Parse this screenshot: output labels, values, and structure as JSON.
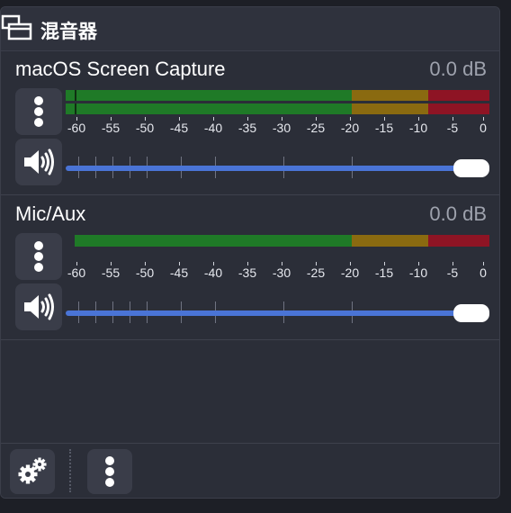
{
  "dock": {
    "title": "混音器",
    "undock_icon": "undock-window-icon"
  },
  "channels": [
    {
      "name": "macOS Screen Capture",
      "db": "0.0 dB",
      "meter_rows": 2,
      "volume_level": 1.0
    },
    {
      "name": "Mic/Aux",
      "db": "0.0 dB",
      "meter_rows": 1,
      "volume_level": 1.0
    }
  ],
  "scale_labels": [
    "-60",
    "-55",
    "-50",
    "-45",
    "-40",
    "-35",
    "-30",
    "-25",
    "-20",
    "-15",
    "-10",
    "-5",
    "0"
  ],
  "colors": {
    "meter_green": "#1f7a27",
    "meter_yellow": "#8a6a10",
    "meter_red": "#8e1424",
    "slider_fill": "#4a74d6"
  },
  "bottom_bar": {
    "settings_icon": "gears-icon",
    "more_icon": "kebab-menu-icon"
  }
}
